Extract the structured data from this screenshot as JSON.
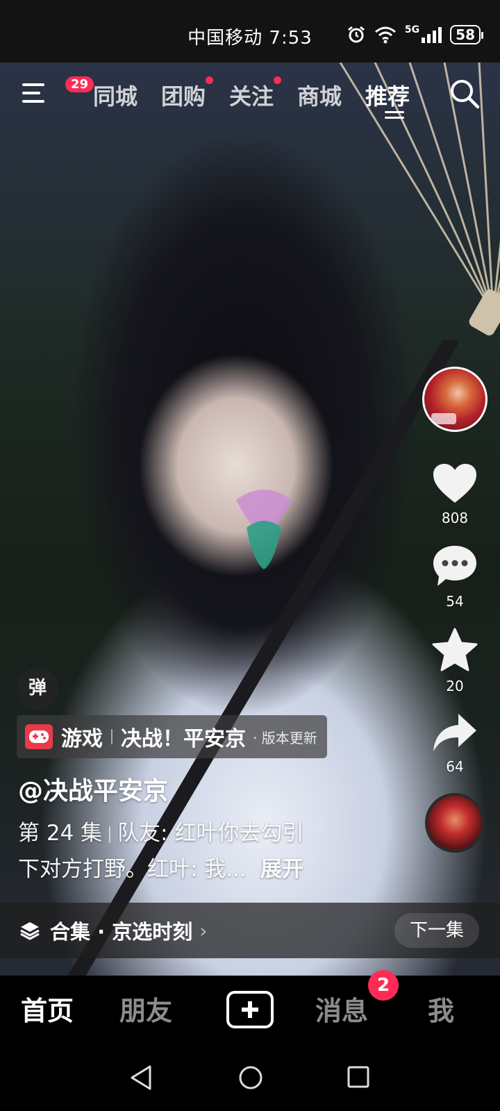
{
  "status_bar": {
    "carrier_time": "中国移动 7:53",
    "network": "5G",
    "battery": "58"
  },
  "top_nav": {
    "menu_badge": "29",
    "tabs": [
      {
        "label": "同城",
        "dot": false
      },
      {
        "label": "团购",
        "dot": true
      },
      {
        "label": "关注",
        "dot": true
      },
      {
        "label": "商城",
        "dot": false
      },
      {
        "label": "推荐",
        "active": true
      }
    ],
    "search_icon": "search-icon"
  },
  "right_rail": {
    "like_count": "808",
    "comment_count": "54",
    "favorite_count": "20",
    "share_count": "64"
  },
  "video_info": {
    "danmu_label": "弹",
    "game_tag": {
      "category": "游戏",
      "name": "决战！平安京",
      "suffix": "· 版本更新"
    },
    "author": "@决战平安京",
    "episode": "第 24 集",
    "description_line1": "队友: 红叶你去勾引",
    "description_line2": "下对方打野。红叶: 我...",
    "expand_label": "展开"
  },
  "collection": {
    "label": "合集 · 京选时刻",
    "next_label": "下一集"
  },
  "bottom_tabs": {
    "home": "首页",
    "friends": "朋友",
    "messages": "消息",
    "messages_badge": "2",
    "me": "我"
  },
  "colors": {
    "accent": "#fe2c55",
    "background": "#000000"
  }
}
